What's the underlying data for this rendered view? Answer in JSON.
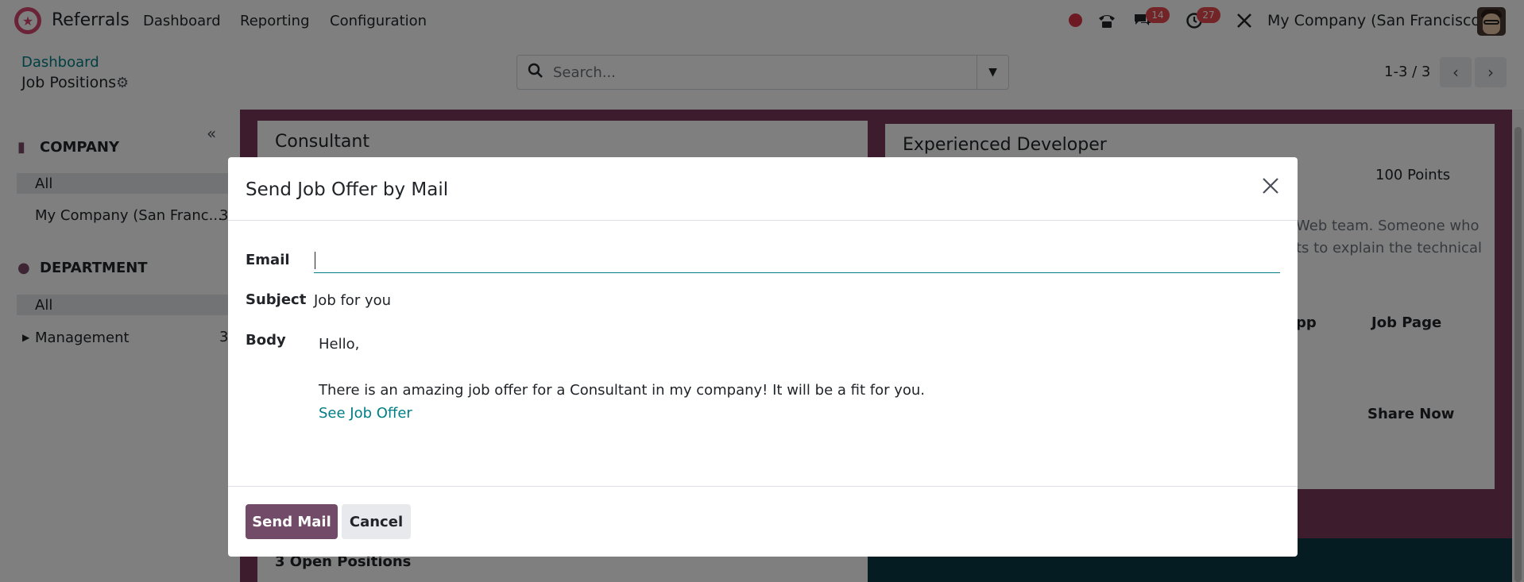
{
  "app": {
    "name": "Referrals"
  },
  "nav": {
    "items": [
      "Dashboard",
      "Reporting",
      "Configuration"
    ]
  },
  "systray": {
    "messages_badge": "14",
    "activities_badge": "27",
    "company": "My Company (San Francisco)"
  },
  "control_panel": {
    "breadcrumb": "Dashboard",
    "title": "Job Positions",
    "search_placeholder": "Search...",
    "pager": "1-3 / 3"
  },
  "sidebar": {
    "company_heading": "COMPANY",
    "company_items": [
      {
        "label": "All",
        "count": ""
      },
      {
        "label": "My Company (San Franc...",
        "count": "3"
      }
    ],
    "department_heading": "DEPARTMENT",
    "department_items": [
      {
        "label": "All",
        "count": ""
      },
      {
        "label": "Management",
        "count": "3"
      }
    ]
  },
  "kanban": {
    "cards": [
      {
        "title": "Consultant",
        "footer": "3 Open Positions"
      },
      {
        "title": "Experienced Developer",
        "points": "100 Points",
        "description_line1": "Web team. Someone who",
        "description_line2": "ts to explain the technical",
        "btn_app": "pp",
        "btn_job_page": "Job Page",
        "btn_share": "Share Now"
      }
    ]
  },
  "dialog": {
    "title": "Send Job Offer by Mail",
    "email_label": "Email",
    "email_value": "",
    "subject_label": "Subject",
    "subject_value": "Job for you",
    "body_label": "Body",
    "body_greeting": "Hello,",
    "body_text": "There is an amazing job offer for a Consultant in my company! It will be a fit for you.",
    "body_link": "See Job Offer",
    "send_button": "Send Mail",
    "cancel_button": "Cancel"
  },
  "colors": {
    "primary": "#714b67",
    "link": "#017e84",
    "badge": "#e5484d",
    "kanban_bg": "#7a3a5a"
  }
}
